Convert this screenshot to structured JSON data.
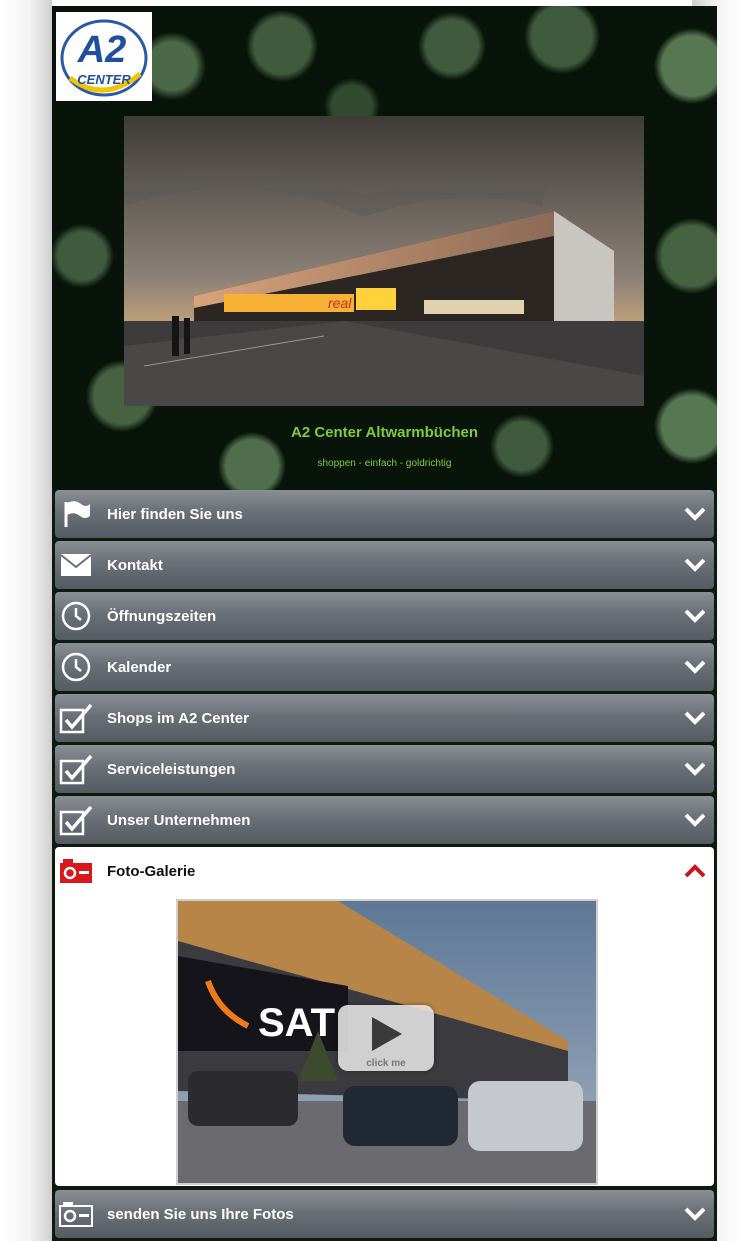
{
  "logo": {
    "line1": "A2",
    "line2": "CENTER"
  },
  "hero": {
    "title": "A2 Center Altwarmbüchen",
    "tagline": "shoppen - einfach - goldrichtig",
    "photo_sign": "real"
  },
  "menu": [
    {
      "label": "Hier finden Sie uns",
      "icon": "flag-icon",
      "expanded": false
    },
    {
      "label": "Kontakt",
      "icon": "envelope-icon",
      "expanded": false
    },
    {
      "label": "Öffnungszeiten",
      "icon": "clock-icon",
      "expanded": false
    },
    {
      "label": "Kalender",
      "icon": "clock-icon",
      "expanded": false
    },
    {
      "label": "Shops im A2 Center",
      "icon": "checkbox-icon",
      "expanded": false
    },
    {
      "label": "Serviceleistungen",
      "icon": "checkbox-icon",
      "expanded": false
    },
    {
      "label": "Unser Unternehmen",
      "icon": "checkbox-icon",
      "expanded": false
    },
    {
      "label": "Foto-Galerie",
      "icon": "camera-icon",
      "expanded": true
    },
    {
      "label": "senden Sie uns Ihre Fotos",
      "icon": "camera-icon",
      "expanded": false
    }
  ],
  "gallery": {
    "store_sign": "SAT",
    "play_caption": "click me"
  },
  "colors": {
    "accent_green": "#7ecb3b",
    "menu_gray": "#6a7077",
    "camera_red": "#d8191b",
    "chevron_red": "#c8141b"
  }
}
